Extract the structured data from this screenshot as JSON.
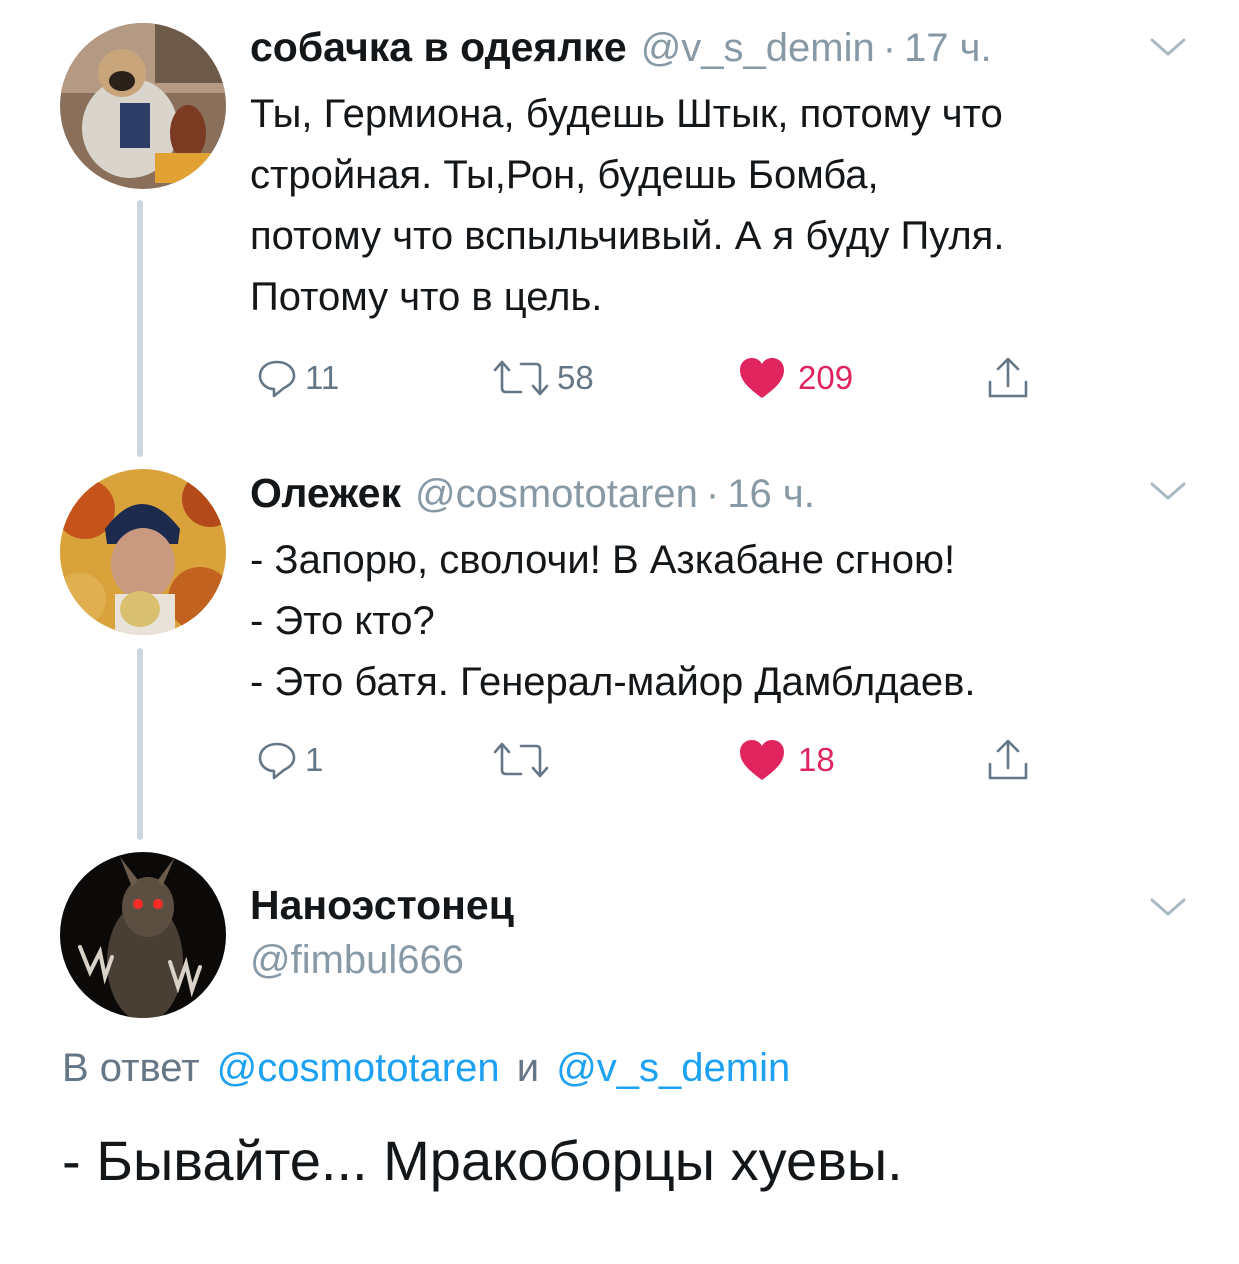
{
  "tweets": [
    {
      "name": "собачка в одеялке",
      "handle": "@v_s_demin",
      "sep": "·",
      "time": "17 ч.",
      "lines": [
        "Ты, Гермиона, будешь Штык, потому что",
        "стройная. Ты,Рон, будешь Бомба,",
        "потому что вспыльчивый. А я буду Пуля.",
        "Потому что в цель."
      ],
      "replies": "11",
      "retweets": "58",
      "likes": "209"
    },
    {
      "name": "Олежек",
      "handle": "@cosmototaren",
      "sep": "·",
      "time": "16 ч.",
      "lines": [
        "- Запорю, сволочи! В Азкабане сгною!",
        "- Это кто?",
        "- Это батя. Генерал-майор Дамблдаев."
      ],
      "replies": "1",
      "retweets": "",
      "likes": "18"
    }
  ],
  "main_tweet": {
    "name": "Наноэстонец",
    "handle": "@fimbul666",
    "reply_prefix": "В ответ",
    "reply_to_1": "@cosmototaren",
    "reply_and": "и",
    "reply_to_2": "@v_s_demin",
    "text": "- Бывайте... Мракоборцы хуевы."
  },
  "colors": {
    "link": "#1da1f2",
    "muted": "#8899a6",
    "like": "#e0245e",
    "thread_line": "#ccd6dd"
  },
  "icons": [
    "reply-icon",
    "retweet-icon",
    "heart-icon",
    "share-icon",
    "chevron-down-icon"
  ]
}
